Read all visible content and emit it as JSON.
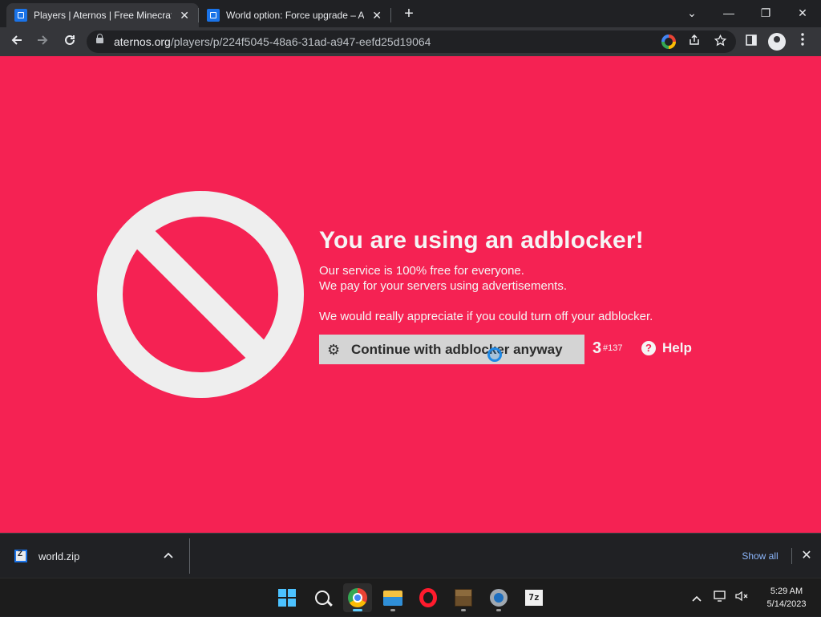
{
  "browser": {
    "tabs": [
      {
        "title": "Players | Aternos | Free Minecraft",
        "close": "✕"
      },
      {
        "title": "World option: Force upgrade – A",
        "close": "✕"
      }
    ],
    "new_tab": "+",
    "window_controls": {
      "dropdown": "⌄",
      "minimize": "—",
      "restore": "❐",
      "close": "✕"
    },
    "url_host": "aternos.org",
    "url_path": "/players/p/224f5045-48a6-31ad-a947-eefd25d19064"
  },
  "page": {
    "background": "#f52253",
    "heading": "You are using an adblocker!",
    "line1": "Our service is 100% free for everyone.",
    "line2": "We pay for your servers using advertisements.",
    "line3": "We would really appreciate if you could turn off your adblocker.",
    "continue_label": "Continue with adblocker anyway",
    "counter": "3",
    "counter_sub": "#137",
    "help_label": "Help",
    "help_icon": "?"
  },
  "downloads": {
    "file_name": "world.zip",
    "show_all": "Show all",
    "close": "✕"
  },
  "taskbar": {
    "time": "5:29 AM",
    "date": "5/14/2023",
    "sevenzip_label": "7z"
  }
}
